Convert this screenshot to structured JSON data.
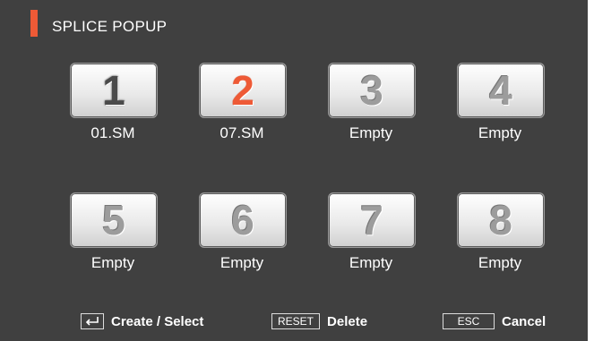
{
  "popup": {
    "title": "SPLICE POPUP",
    "accent_color": "#ee5a36"
  },
  "slots": [
    {
      "number": "1",
      "label": "01.SM",
      "state": "used"
    },
    {
      "number": "2",
      "label": "07.SM",
      "state": "selected"
    },
    {
      "number": "3",
      "label": "Empty",
      "state": "empty"
    },
    {
      "number": "4",
      "label": "Empty",
      "state": "empty"
    },
    {
      "number": "5",
      "label": "Empty",
      "state": "empty"
    },
    {
      "number": "6",
      "label": "Empty",
      "state": "empty"
    },
    {
      "number": "7",
      "label": "Empty",
      "state": "empty"
    },
    {
      "number": "8",
      "label": "Empty",
      "state": "empty"
    }
  ],
  "footer": {
    "enter": {
      "icon": "enter-icon",
      "label": "Create / Select"
    },
    "reset": {
      "key": "RESET",
      "label": "Delete"
    },
    "esc": {
      "key": "ESC",
      "label": "Cancel"
    }
  }
}
